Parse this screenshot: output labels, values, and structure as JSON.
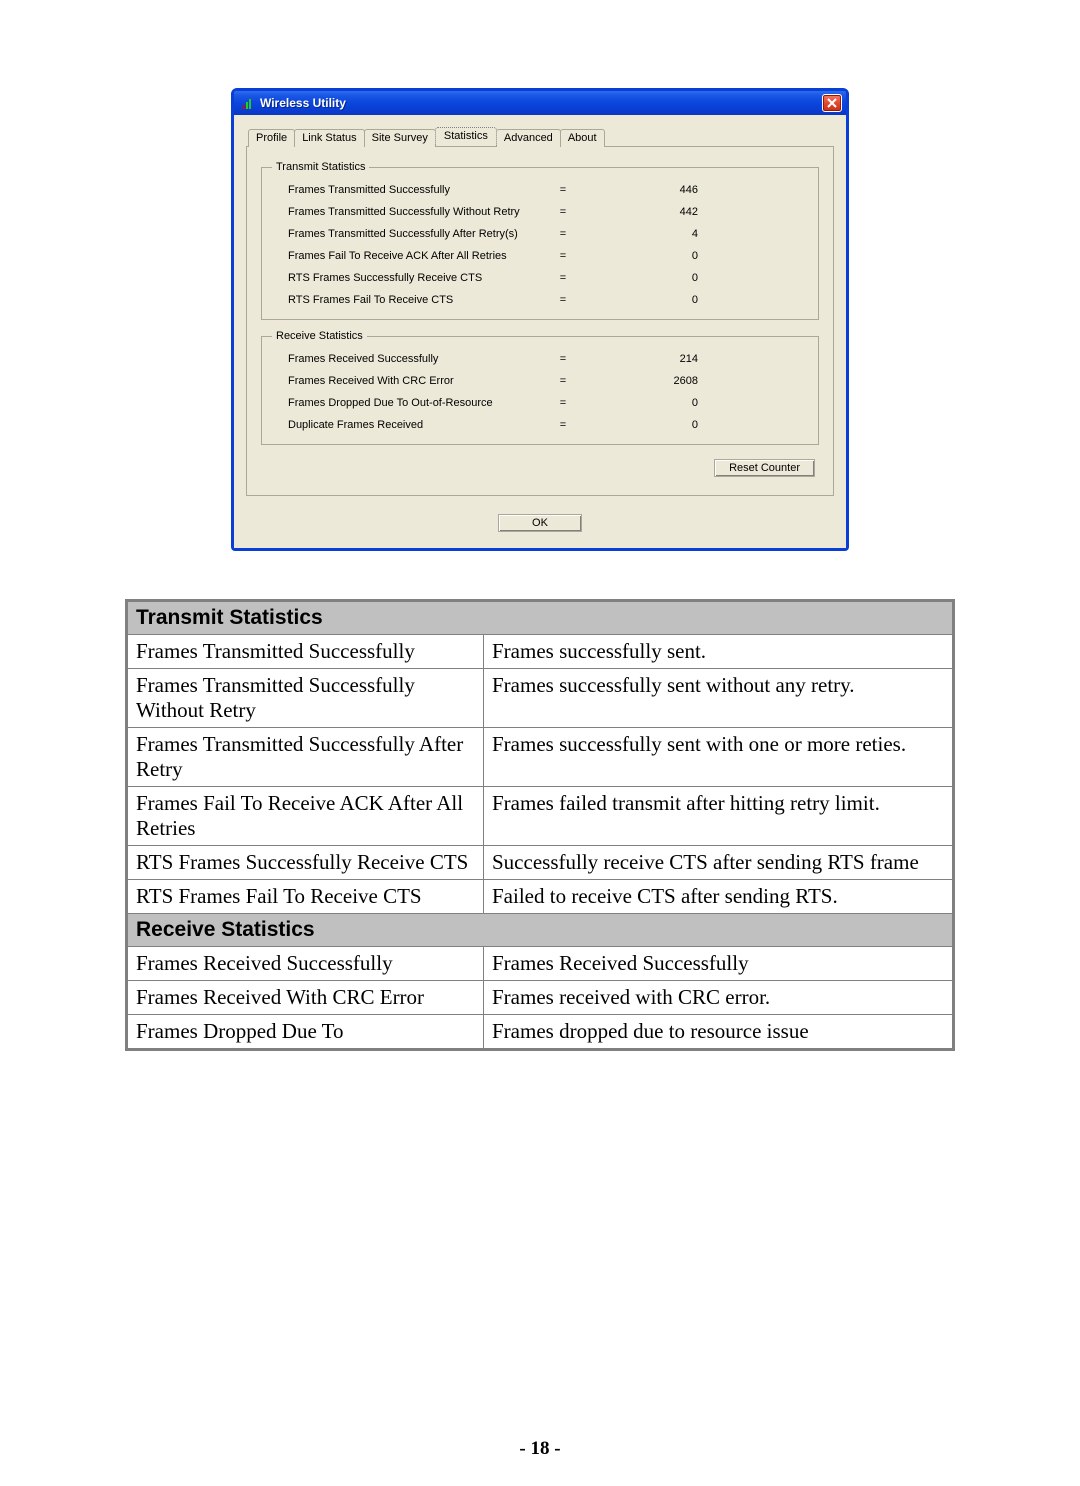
{
  "window": {
    "title": "Wireless Utility",
    "tabs": [
      "Profile",
      "Link Status",
      "Site Survey",
      "Statistics",
      "Advanced",
      "About"
    ],
    "active_tab_index": 3,
    "transmit_group_label": "Transmit Statistics",
    "receive_group_label": "Receive Statistics",
    "transmit_stats": [
      {
        "label": "Frames Transmitted Successfully",
        "value": "446"
      },
      {
        "label": "Frames Transmitted Successfully  Without Retry",
        "value": "442"
      },
      {
        "label": "Frames Transmitted Successfully After Retry(s)",
        "value": "4"
      },
      {
        "label": "Frames Fail To Receive ACK After All Retries",
        "value": "0"
      },
      {
        "label": "RTS Frames Successfully Receive CTS",
        "value": "0"
      },
      {
        "label": "RTS Frames Fail To Receive CTS",
        "value": "0"
      }
    ],
    "receive_stats": [
      {
        "label": "Frames Received Successfully",
        "value": "214"
      },
      {
        "label": "Frames Received With CRC Error",
        "value": "2608"
      },
      {
        "label": "Frames Dropped Due To Out-of-Resource",
        "value": "0"
      },
      {
        "label": "Duplicate Frames Received",
        "value": "0"
      }
    ],
    "reset_btn": "Reset Counter",
    "ok_btn": "OK"
  },
  "desc_table": {
    "transmit_header": "Transmit Statistics",
    "receive_header": "Receive Statistics",
    "transmit_rows": [
      {
        "term": "Frames Transmitted Successfully",
        "desc": "Frames successfully sent."
      },
      {
        "term": "Frames Transmitted Successfully Without Retry",
        "desc": "Frames successfully sent without any retry."
      },
      {
        "term": "Frames Transmitted Successfully After Retry",
        "desc": "Frames successfully sent with one or more reties."
      },
      {
        "term": "Frames Fail To Receive ACK After All Retries",
        "desc": "Frames failed transmit after hitting retry limit."
      },
      {
        "term": "RTS Frames Successfully Receive CTS",
        "desc": "Successfully receive CTS after sending RTS frame"
      },
      {
        "term": "RTS Frames Fail To Receive CTS",
        "desc": "Failed to receive CTS after sending RTS."
      }
    ],
    "receive_rows": [
      {
        "term": "Frames Received Successfully",
        "desc": "Frames Received Successfully"
      },
      {
        "term": "Frames Received With CRC Error",
        "desc": "Frames received with CRC error."
      },
      {
        "term": "Frames Dropped Due To",
        "desc": "Frames dropped due to resource issue"
      }
    ]
  },
  "page_number": "- 18 -"
}
